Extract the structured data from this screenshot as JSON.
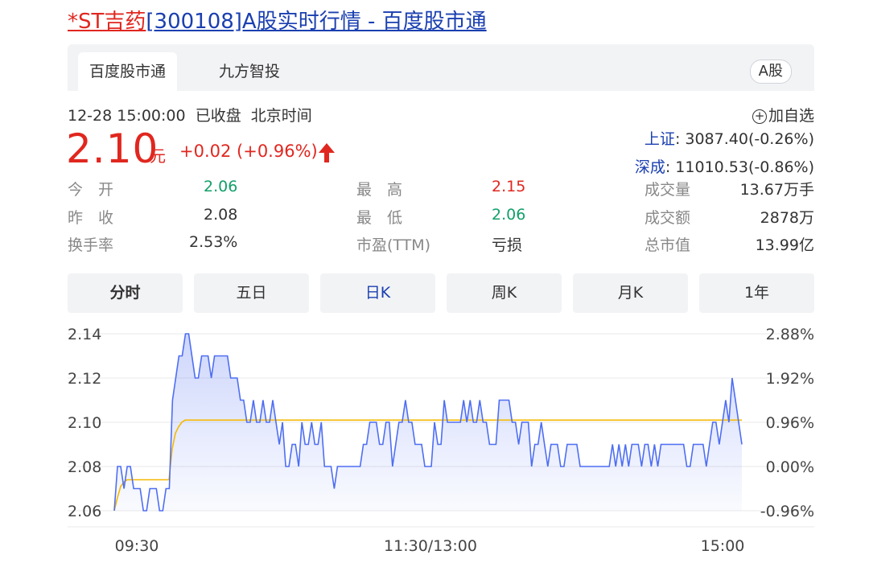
{
  "page": {
    "title_red": "*ST吉药",
    "title_blue": "[300108]A股实时行情 - 百度股市通"
  },
  "tabs": [
    {
      "label": "百度股市通",
      "active": true
    },
    {
      "label": "九方智投",
      "active": false
    }
  ],
  "market_badge": "A股",
  "quote": {
    "timestamp": "12-28 15:00:00",
    "status": "已收盘",
    "timezone": "北京时间",
    "add_watchlist": "加自选",
    "price": "2.10",
    "unit": "元",
    "change": "+0.02 (+0.96%)"
  },
  "indices": [
    {
      "label": "上证",
      "value": ": 3087.40(-0.26%)"
    },
    {
      "label": "深成",
      "value": ": 11010.53(-0.86%)"
    }
  ],
  "stats": {
    "open_label": "今　开",
    "open": "2.06",
    "prev_label": "昨　收",
    "prev": "2.08",
    "turnover_label": "换手率",
    "turnover": "2.53%",
    "high_label": "最　高",
    "high": "2.15",
    "low_label": "最　低",
    "low": "2.06",
    "pe_label": "市盈(TTM)",
    "pe": "亏损",
    "volume_label": "成交量",
    "volume": "13.67万手",
    "amount_label": "成交额",
    "amount": "2878万",
    "mcap_label": "总市值",
    "mcap": "13.99亿"
  },
  "periods": [
    {
      "label": "分时",
      "active": true
    },
    {
      "label": "五日",
      "active": false
    },
    {
      "label": "日K",
      "active": false
    },
    {
      "label": "周K",
      "active": false
    },
    {
      "label": "月K",
      "active": false
    },
    {
      "label": "1年",
      "active": false
    }
  ],
  "colors": {
    "red": "#e0271f",
    "green": "#12a06a",
    "blue_link": "#1a3fb0",
    "price_line": "#4e6ef2",
    "avg_line": "#f5b800"
  },
  "chart_data": {
    "type": "line",
    "ylim": [
      2.06,
      2.14
    ],
    "y_ticks": [
      "2.14",
      "2.12",
      "2.10",
      "2.08",
      "2.06"
    ],
    "y_right_ticks": [
      "2.88%",
      "1.92%",
      "0.96%",
      "0.00%",
      "-0.96%"
    ],
    "x_ticks": [
      "09:30",
      "11:30/13:00",
      "15:00"
    ],
    "series": [
      {
        "values": [
          2.06,
          2.08,
          2.08,
          2.07,
          2.08,
          2.08,
          2.07,
          2.07,
          2.07,
          2.06,
          2.06,
          2.07,
          2.07,
          2.07,
          2.06,
          2.06,
          2.07,
          2.07,
          2.11,
          2.12,
          2.13,
          2.13,
          2.14,
          2.14,
          2.13,
          2.12,
          2.12,
          2.13,
          2.13,
          2.13,
          2.12,
          2.13,
          2.13,
          2.13,
          2.13,
          2.13,
          2.12,
          2.12,
          2.12,
          2.11,
          2.11,
          2.1,
          2.1,
          2.11,
          2.1,
          2.1,
          2.11,
          2.1,
          2.1,
          2.11,
          2.1,
          2.09,
          2.1,
          2.08,
          2.08,
          2.09,
          2.09,
          2.08,
          2.1,
          2.09,
          2.09,
          2.1,
          2.09,
          2.09,
          2.1,
          2.08,
          2.08,
          2.08,
          2.07,
          2.08,
          2.08,
          2.08,
          2.08,
          2.08,
          2.08,
          2.08,
          2.08,
          2.09,
          2.09,
          2.1,
          2.1,
          2.1,
          2.09,
          2.09,
          2.1,
          2.1,
          2.08,
          2.09,
          2.1,
          2.1,
          2.11,
          2.1,
          2.1,
          2.09,
          2.09,
          2.09,
          2.08,
          2.08,
          2.08,
          2.1,
          2.09,
          2.09,
          2.11,
          2.1,
          2.1,
          2.1,
          2.1,
          2.1,
          2.11,
          2.1,
          2.11,
          2.1,
          2.1,
          2.11,
          2.1,
          2.1,
          2.09,
          2.09,
          2.09,
          2.11,
          2.11,
          2.11,
          2.11,
          2.1,
          2.1,
          2.09,
          2.1,
          2.1,
          2.1,
          2.08,
          2.09,
          2.09,
          2.1,
          2.09,
          2.08,
          2.09,
          2.09,
          2.09,
          2.08,
          2.08,
          2.09,
          2.09,
          2.09,
          2.09,
          2.08,
          2.08,
          2.08,
          2.08,
          2.08,
          2.08,
          2.08,
          2.08,
          2.08,
          2.08,
          2.09,
          2.08,
          2.09,
          2.08,
          2.09,
          2.08,
          2.09,
          2.09,
          2.09,
          2.08,
          2.09,
          2.09,
          2.08,
          2.09,
          2.08,
          2.09,
          2.09,
          2.09,
          2.09,
          2.09,
          2.09,
          2.09,
          2.09,
          2.08,
          2.08,
          2.09,
          2.09,
          2.09,
          2.09,
          2.08,
          2.09,
          2.1,
          2.1,
          2.09,
          2.1,
          2.11,
          2.1,
          2.12,
          2.11,
          2.1,
          2.09
        ]
      },
      {
        "values": [
          2.06,
          2.066,
          2.071,
          2.073,
          2.074,
          2.074,
          2.074,
          2.074,
          2.074,
          2.074,
          2.074,
          2.074,
          2.074,
          2.074,
          2.074,
          2.074,
          2.074,
          2.074,
          2.088,
          2.095,
          2.098,
          2.1,
          2.101,
          2.101,
          2.101,
          2.101,
          2.101,
          2.101,
          2.101,
          2.101,
          2.101,
          2.101,
          2.101,
          2.101,
          2.101,
          2.101,
          2.101,
          2.101,
          2.101,
          2.101,
          2.101,
          2.101,
          2.101,
          2.101,
          2.101,
          2.101,
          2.101,
          2.101,
          2.101,
          2.101,
          2.101,
          2.101,
          2.101,
          2.101,
          2.101,
          2.101,
          2.101,
          2.101,
          2.101,
          2.101,
          2.101,
          2.101,
          2.101,
          2.101,
          2.101,
          2.101,
          2.101,
          2.101,
          2.101,
          2.101,
          2.101,
          2.101,
          2.101,
          2.101,
          2.101,
          2.101,
          2.101,
          2.101,
          2.101,
          2.101,
          2.101,
          2.101,
          2.101,
          2.101,
          2.101,
          2.101,
          2.101,
          2.101,
          2.101,
          2.101,
          2.101,
          2.101,
          2.101,
          2.101,
          2.101,
          2.101,
          2.101,
          2.101,
          2.101,
          2.101,
          2.101,
          2.101,
          2.101,
          2.101,
          2.101,
          2.101,
          2.101,
          2.101,
          2.101,
          2.101,
          2.101,
          2.101,
          2.101,
          2.101,
          2.101,
          2.101,
          2.101,
          2.101,
          2.101,
          2.101,
          2.101,
          2.101,
          2.101,
          2.101,
          2.101,
          2.101,
          2.101,
          2.101,
          2.101,
          2.101,
          2.101,
          2.101,
          2.101,
          2.101,
          2.101,
          2.101,
          2.101,
          2.101,
          2.101,
          2.101,
          2.101,
          2.101,
          2.101,
          2.101,
          2.101,
          2.101,
          2.101,
          2.101,
          2.101,
          2.101,
          2.101,
          2.101,
          2.101,
          2.101,
          2.101,
          2.101,
          2.101,
          2.101,
          2.101,
          2.101,
          2.101,
          2.101,
          2.101,
          2.101,
          2.101,
          2.101,
          2.101,
          2.101,
          2.101,
          2.101,
          2.101,
          2.101,
          2.101,
          2.101,
          2.101,
          2.101,
          2.101,
          2.101,
          2.101,
          2.101,
          2.101,
          2.101,
          2.101,
          2.101,
          2.101,
          2.101,
          2.101,
          2.101,
          2.101,
          2.101,
          2.101,
          2.101,
          2.101,
          2.101,
          2.101,
          2.101
        ]
      }
    ],
    "grid": true
  }
}
